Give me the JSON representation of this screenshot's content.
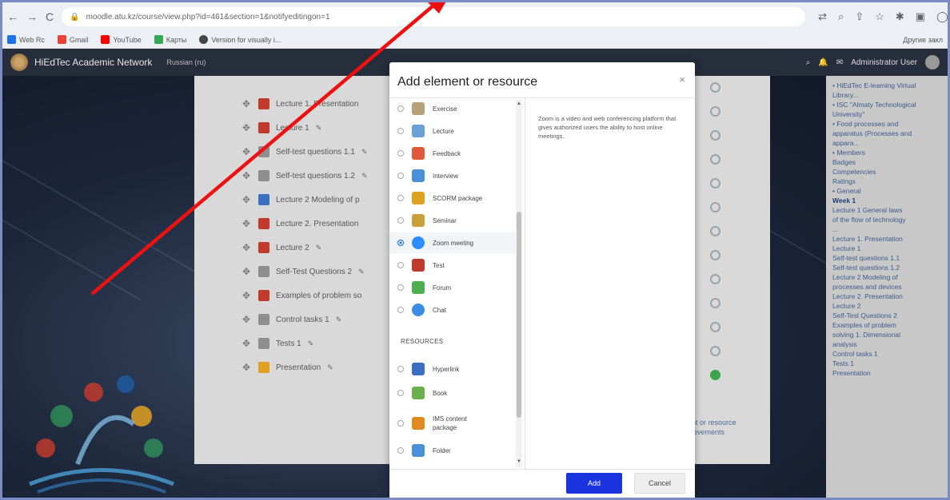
{
  "browser": {
    "url": "moodle.atu.kz/course/view.php?id=461&section=1&notifyeditingon=1",
    "bookmarks": [
      {
        "label": "Web Rc",
        "color": "#1a73e8"
      },
      {
        "label": "Gmail",
        "color": "#ea4335"
      },
      {
        "label": "YouTube",
        "color": "#ff0000"
      },
      {
        "label": "Карты",
        "color": "#34a853"
      },
      {
        "label": "Version for visually i...",
        "color": "#444444"
      }
    ],
    "bookmarks_right": "Другие закл"
  },
  "moodle": {
    "site_name": "HiEdTec Academic Network",
    "language": "Russian (ru)",
    "user_label": "Administrator User"
  },
  "course_activities": [
    {
      "label": "Lecture 1. Presentation",
      "color": "#c0392b"
    },
    {
      "label": "Lecture 1",
      "color": "#c0392b"
    },
    {
      "label": "Self-test questions 1.1",
      "color": "#8e8e8e"
    },
    {
      "label": "Self-test questions 1.2",
      "color": "#8e8e8e"
    },
    {
      "label": "Lecture 2 Modeling of p",
      "color": "#3a6fc4"
    },
    {
      "label": "Lecture 2. Presentation",
      "color": "#c0392b"
    },
    {
      "label": "Lecture 2",
      "color": "#c0392b"
    },
    {
      "label": "Self-Test Questions 2",
      "color": "#8e8e8e"
    },
    {
      "label": "Examples of problem so",
      "color": "#c0392b"
    },
    {
      "label": "Control tasks 1",
      "color": "#8e8e8e"
    },
    {
      "label": "Tests 1",
      "color": "#8e8e8e"
    },
    {
      "label": "Presentation",
      "color": "#e0a020"
    }
  ],
  "behind_note": {
    "line1": "nt or resource",
    "line2": "ievements"
  },
  "drawer": {
    "items": [
      "• HiEdTec E-learning Virtual",
      "Library...",
      "• ISC \"Almaty Technological",
      "University\"",
      "• Food processes and",
      "apparatus (Processes and",
      "appara...",
      "• Members",
      "Badges",
      "Competencies",
      "Ratings",
      "• General",
      "Week 1",
      "Lecture 1 General laws",
      "of the flow of technology",
      "...",
      "Lecture 1. Presentation",
      "Lecture 1",
      "Self-test questions 1.1",
      "Self-test questions 1.2",
      "Lecture 2 Modeling of",
      "processes and devices",
      "Lecture 2. Presentation",
      "Lecture 2",
      "Self-Test Questions 2",
      "Examples of problem",
      "solving 1. Dimensional",
      "analysis",
      "Control tasks 1",
      "Tests 1",
      "Presentation"
    ]
  },
  "modal": {
    "title": "Add element or resource",
    "close": "×",
    "activities": [
      {
        "label": "Exercise",
        "color": "#b8a07a",
        "selected": false
      },
      {
        "label": "Lecture",
        "color": "#6aa0d8",
        "selected": false
      },
      {
        "label": "Feedback",
        "color": "#e05a3a",
        "selected": false
      },
      {
        "label": "Interview",
        "color": "#4a90d9",
        "selected": false
      },
      {
        "label": "SCORM package",
        "color": "#e0a020",
        "selected": false
      },
      {
        "label": "Seminar",
        "color": "#c9a13a",
        "selected": false
      },
      {
        "label": "Zoom meeting",
        "color": "#2d8cff",
        "selected": true
      },
      {
        "label": "Test",
        "color": "#c0392b",
        "selected": false
      },
      {
        "label": "Forum",
        "color": "#4caf50",
        "selected": false
      },
      {
        "label": "Chat",
        "color": "#3a8ee6",
        "selected": false
      }
    ],
    "resources_heading": "RESOURCES",
    "resources": [
      {
        "label": "Hyperlink",
        "color": "#3a6fc4"
      },
      {
        "label": "Book",
        "color": "#6ab04c"
      },
      {
        "label": "IMS content package",
        "color": "#e08a20"
      },
      {
        "label": "Folder",
        "color": "#4a90d9"
      }
    ],
    "description": "Zoom is a video and web conferencing platform that gives authorized users the ability to host online meetings.",
    "add_label": "Add",
    "cancel_label": "Cancel"
  },
  "colors": {
    "arrow": "#ee1111",
    "add_button": "#1a34e0",
    "selected_radio": "#0f6cbf"
  }
}
